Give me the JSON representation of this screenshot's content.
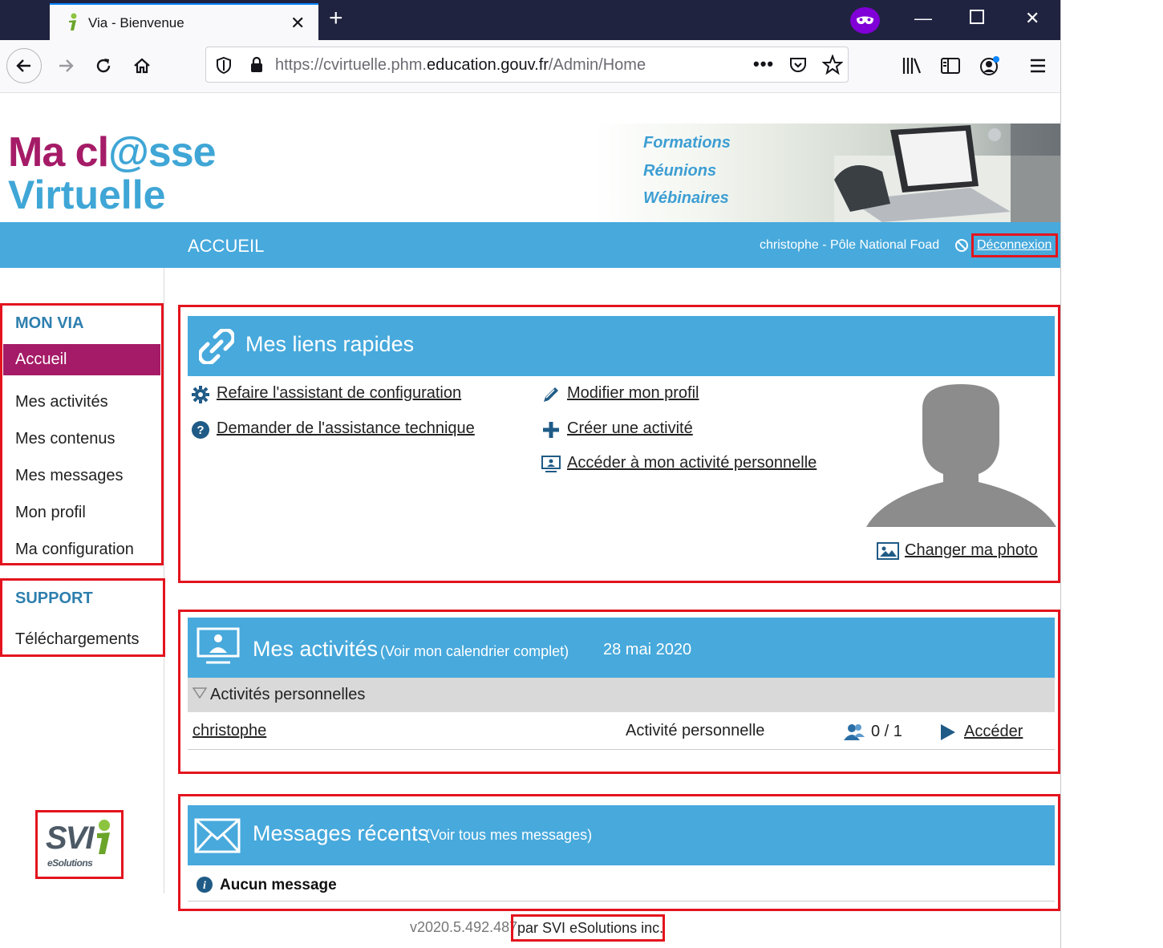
{
  "browser": {
    "tab_title": "Via - Bienvenue",
    "url_prefix": "https://cvirtuelle.phm.",
    "url_domain": "education.gouv.fr",
    "url_path": "/Admin/Home",
    "accent_color": "#0a84ff",
    "private_color": "#8000d7"
  },
  "banner": {
    "logo_line1_a": "Ma cl",
    "logo_line1_at": "@",
    "logo_line1_b": "sse",
    "logo_line2": "Virtuelle",
    "taglines": [
      "Formations",
      "Réunions",
      "Wébinaires"
    ]
  },
  "topnav": {
    "title": "ACCUEIL",
    "user": "christophe  - Pôle National Foad",
    "logout": "Déconnexion",
    "color": "#47a9dc"
  },
  "sidebar": {
    "section1": "MON VIA",
    "items": [
      "Accueil",
      "Mes activités",
      "Mes contenus",
      "Mes messages",
      "Mon profil",
      "Ma configuration"
    ],
    "active_color": "#a51b67",
    "section2": "SUPPORT",
    "support_items": [
      "Téléchargements"
    ]
  },
  "quicklinks": {
    "title": "Mes liens rapides",
    "left": [
      {
        "label": "Refaire l'assistant de configuration",
        "icon": "gear-icon"
      },
      {
        "label": "Demander de l'assistance technique",
        "icon": "help-icon"
      }
    ],
    "right": [
      {
        "label": "Modifier mon profil",
        "icon": "pencil-icon"
      },
      {
        "label": "Créer une activité",
        "icon": "plus-icon"
      },
      {
        "label": "Accéder à mon activité personnelle",
        "icon": "presentation-icon"
      }
    ],
    "change_photo": "Changer ma photo"
  },
  "activities": {
    "title": "Mes activités",
    "calendar_link": "(Voir mon calendrier complet)",
    "date": "28 mai 2020",
    "group": "Activités personnelles",
    "rows": [
      {
        "name": "christophe",
        "type": "Activité personnelle",
        "participants": "0 / 1",
        "action": "Accéder"
      }
    ]
  },
  "messages": {
    "title": "Messages récents",
    "all_link": "(Voir tous mes messages)",
    "empty": "Aucun message"
  },
  "footer": {
    "version": "v2020.5.492.487",
    "by": "par SVI eSolutions inc.",
    "logo_text": "SVI",
    "logo_sub": "eSolutions"
  }
}
